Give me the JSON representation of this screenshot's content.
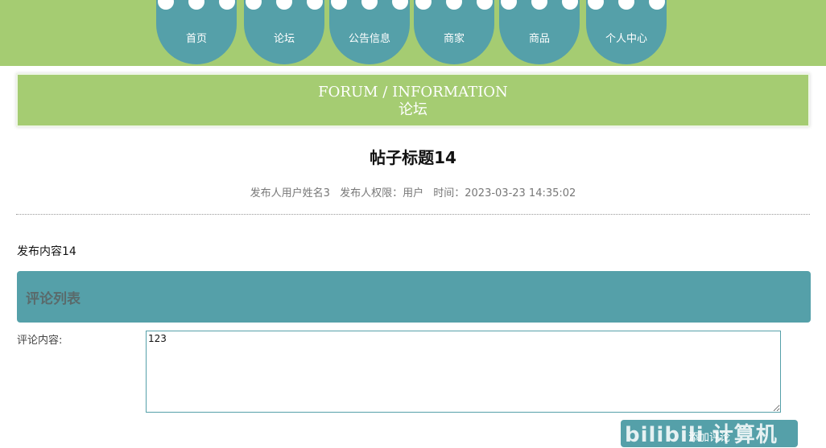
{
  "nav": {
    "items": [
      {
        "label": "首页"
      },
      {
        "label": "论坛"
      },
      {
        "label": "公告信息"
      },
      {
        "label": "商家"
      },
      {
        "label": "商品"
      },
      {
        "label": "个人中心"
      }
    ]
  },
  "banner": {
    "title_en": "FORUM / INFORMATION",
    "title_zh": "论坛"
  },
  "post": {
    "title": "帖子标题14",
    "author": "发布人用户姓名3",
    "permission": "发布人权限：用户",
    "time": "时间：2023-03-23 14:35:02",
    "content": "发布内容14"
  },
  "comments": {
    "header": "评论列表",
    "label": "评论内容:",
    "value": "123",
    "submit_label": "添加评论"
  },
  "watermark": "bilibili 计算机",
  "colors": {
    "accent_green": "#a5cc72",
    "accent_teal": "#55a0a9"
  }
}
